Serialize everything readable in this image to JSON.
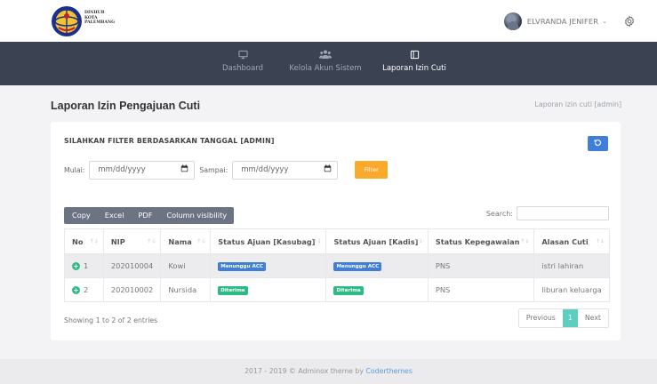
{
  "brand": {
    "logo_line1": "DINHUB",
    "logo_line2": "KOTA",
    "logo_line3": "PALEMBANG"
  },
  "user": {
    "name": "ELVRANDA JENIFER",
    "caret": "⌄",
    "avatar_icon": "user-avatar",
    "settings_icon": "gear-icon"
  },
  "nav": {
    "items": [
      {
        "label": "Dashboard",
        "icon": "monitor-icon"
      },
      {
        "label": "Kelola Akun Sistem",
        "icon": "users-icon"
      },
      {
        "label": "Laporan Izin Cuti",
        "icon": "book-icon"
      }
    ]
  },
  "page": {
    "title": "Laporan Izin Pengajuan Cuti",
    "breadcrumb": "Laporan izin cuti [admin]"
  },
  "card": {
    "title": "SILAHKAN FILTER BERDASARKAN TANGGAL [ADMIN]",
    "refresh_icon": "refresh-icon"
  },
  "filter": {
    "start_label": "Mulai:",
    "start_placeholder": "mm/dd/yyyy",
    "end_label": "Sampai:",
    "end_placeholder": "mm/dd/yyyy",
    "button_label": "Filter"
  },
  "export": {
    "copy": "Copy",
    "excel": "Excel",
    "pdf": "PDF",
    "colvis": "Column visibility"
  },
  "search": {
    "label": "Search:",
    "value": ""
  },
  "table": {
    "headers": [
      "No",
      "NIP",
      "Nama",
      "Status Ajuan [Kasubag]",
      "Status Ajuan [Kadis]",
      "Status Kepegawaian",
      "Alasan Cuti"
    ],
    "rows": [
      {
        "no": "1",
        "nip": "202010004",
        "nama": "Kowi",
        "kasubag": "Menunggu ACC",
        "kadis": "Menunggu ACC",
        "kepegawaian": "PNS",
        "alasan": "istri lahiran"
      },
      {
        "no": "2",
        "nip": "202010002",
        "nama": "Nursida",
        "kasubag": "Diterima",
        "kadis": "Diterima",
        "kepegawaian": "PNS",
        "alasan": "liburan keluarga"
      }
    ]
  },
  "info": "Showing 1 to 2 of 2 entries",
  "pagination": {
    "previous": "Previous",
    "current": "1",
    "next": "Next"
  },
  "footer": {
    "text": "2017 - 2019 © Adminox theme by ",
    "link": "Coderthemes"
  },
  "colors": {
    "nav_bg": "#3b4352",
    "primary": "#3f7fd9",
    "success": "#2dbb85",
    "warning": "#fba92a",
    "page_active": "#5dcfbf"
  }
}
